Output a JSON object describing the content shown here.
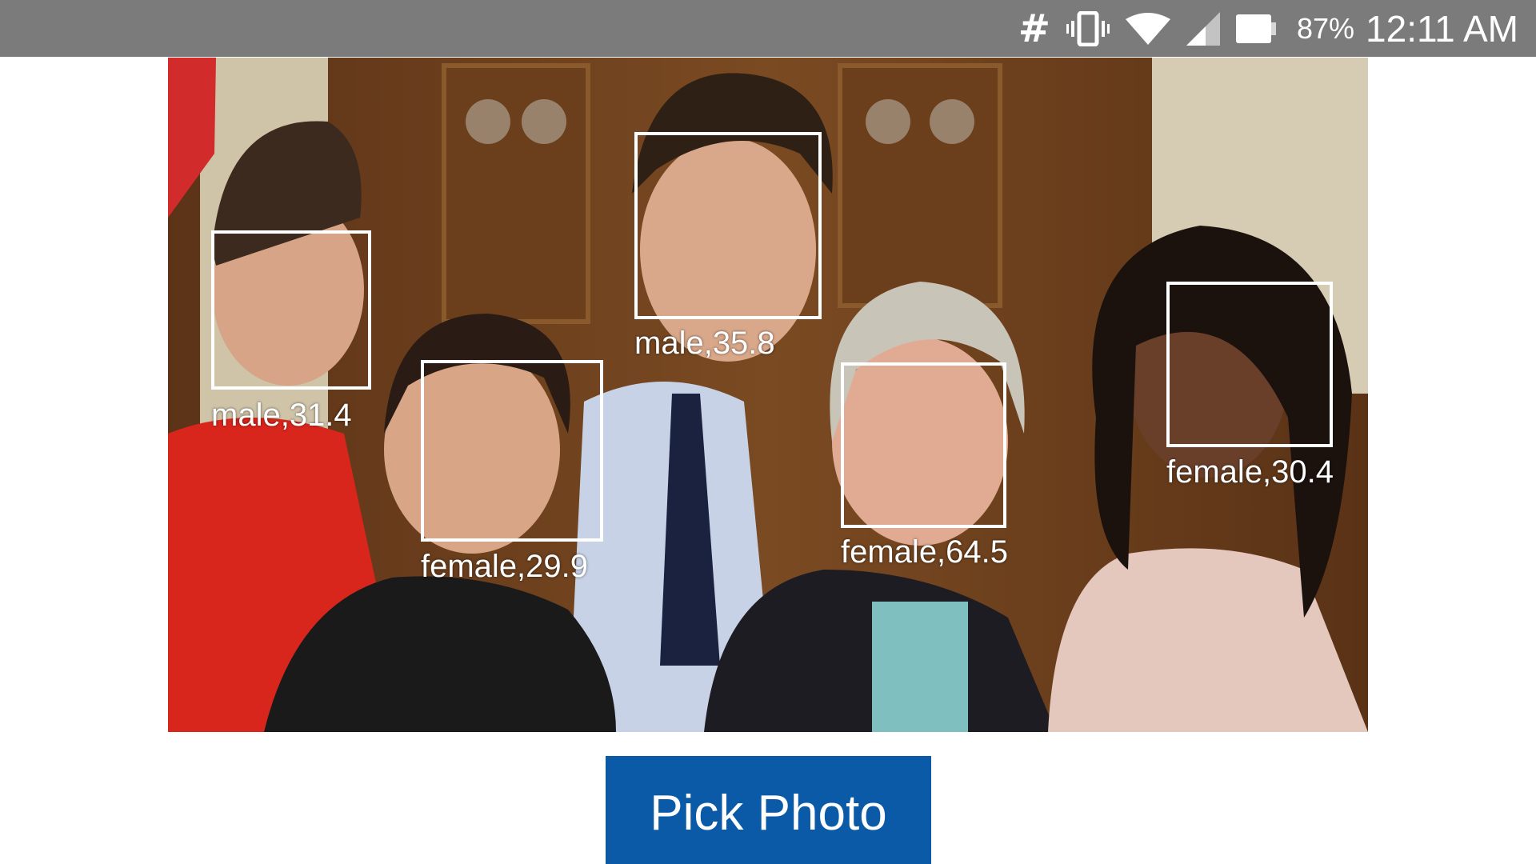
{
  "status_bar": {
    "icons": [
      "hash-icon",
      "vibrate-icon",
      "wifi-icon",
      "signal-icon",
      "battery-icon"
    ],
    "battery_percent": "87%",
    "time": "12:11 AM"
  },
  "photo": {
    "faces": [
      {
        "label": "male,31.4"
      },
      {
        "label": "female,29.9"
      },
      {
        "label": "male,35.8"
      },
      {
        "label": "female,64.5"
      },
      {
        "label": "female,30.4"
      }
    ]
  },
  "actions": {
    "pick_photo_label": "Pick Photo"
  },
  "colors": {
    "status_bar_bg": "#7b7b7b",
    "button_bg": "#0a5aa7",
    "box_color": "#ffffff"
  }
}
